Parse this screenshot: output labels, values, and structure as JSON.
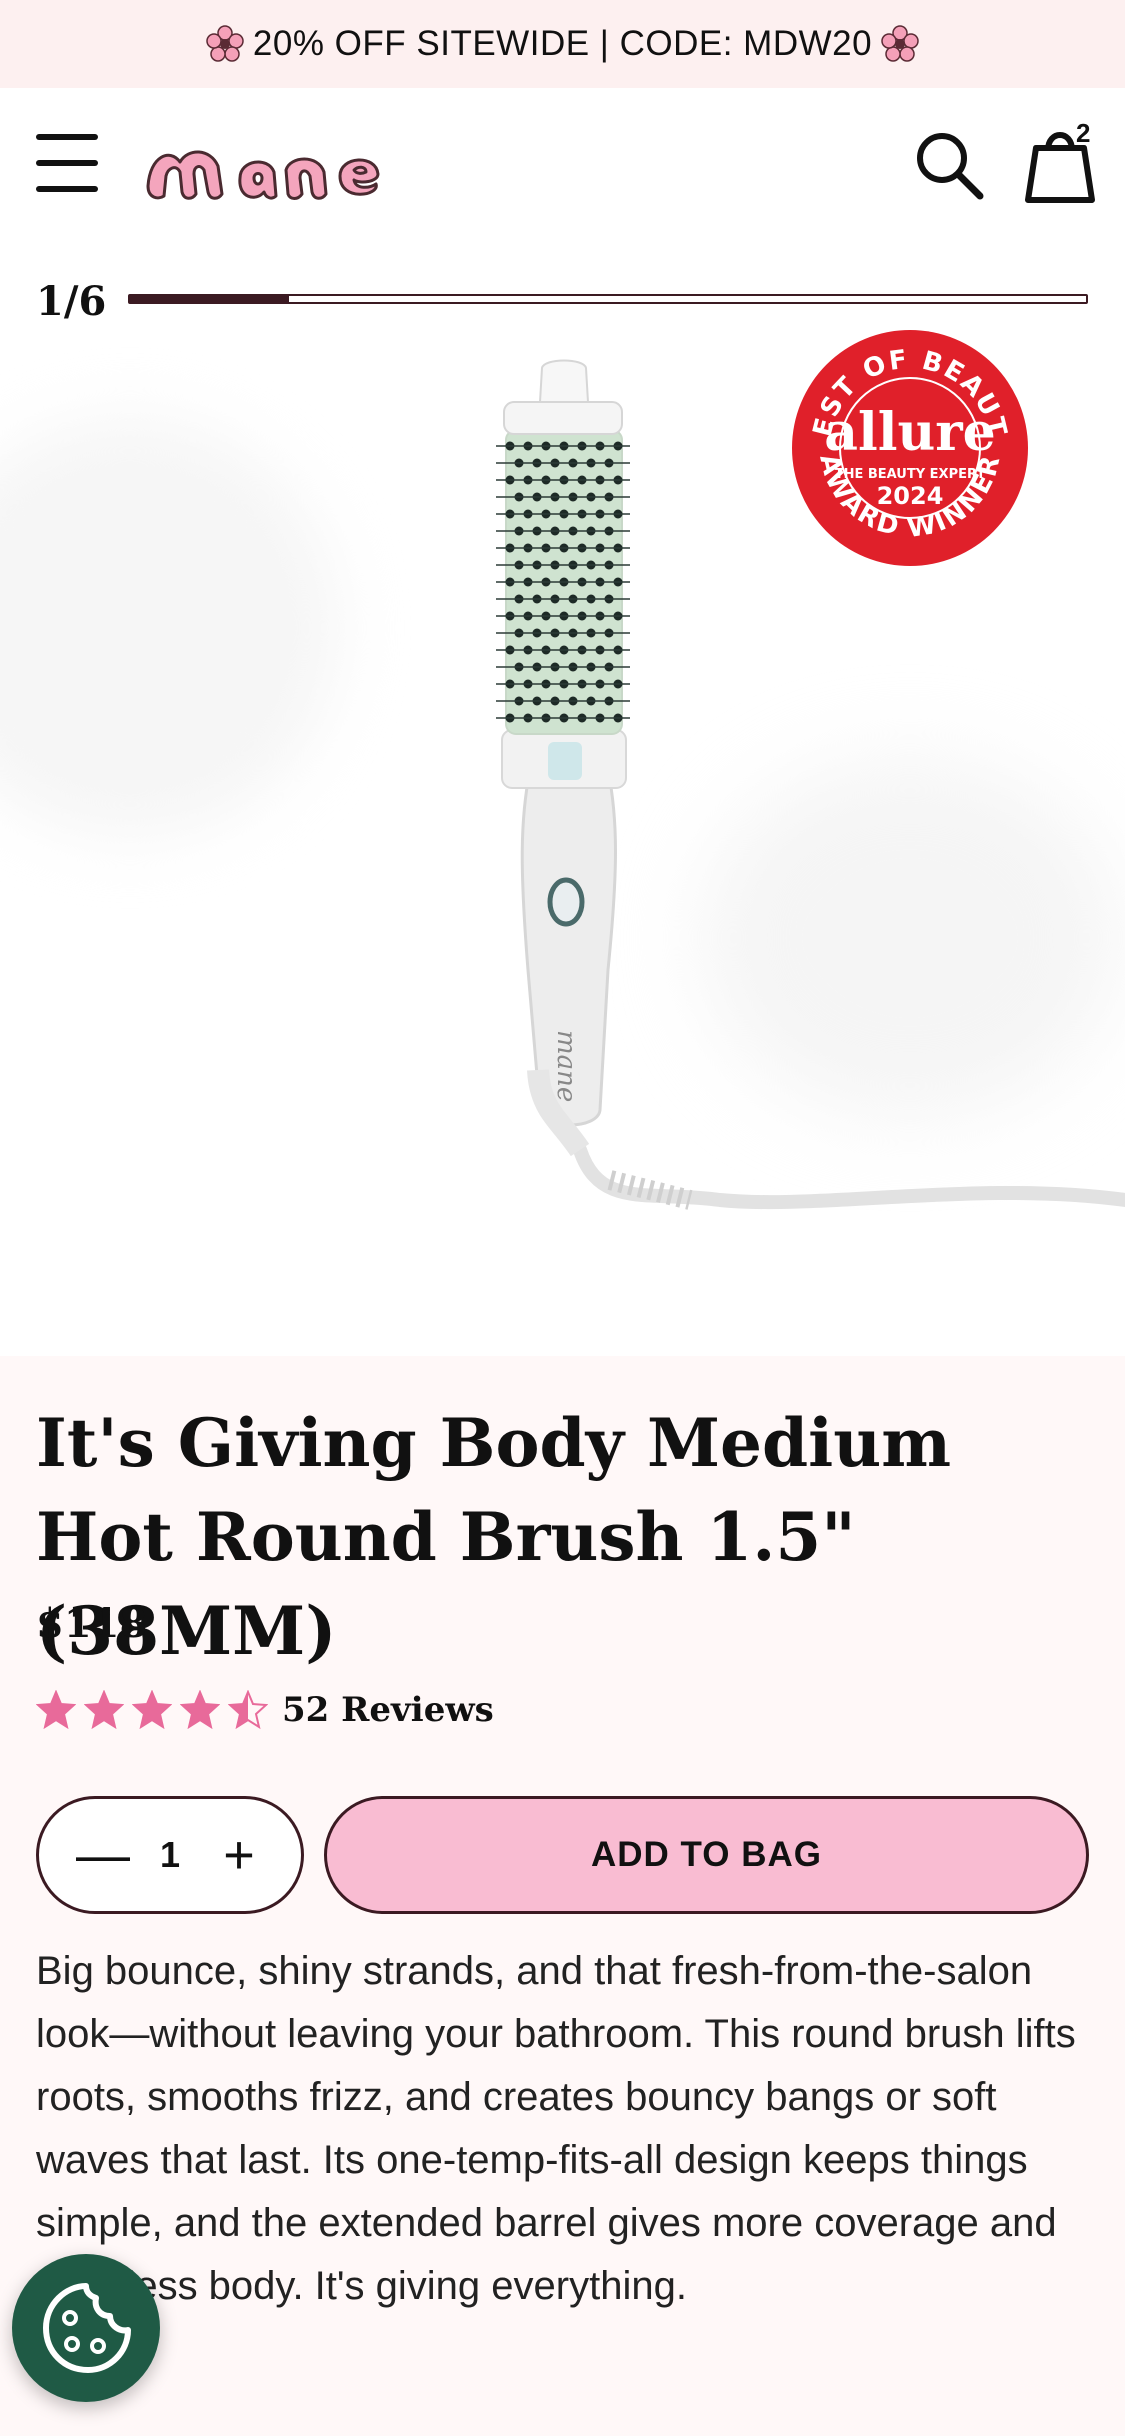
{
  "promo": {
    "text": "20% OFF SITEWIDE | CODE: MDW20"
  },
  "header": {
    "logo_alt": "mane",
    "cart_count": "2"
  },
  "gallery": {
    "counter": "1/6",
    "progress_fraction": 0.1667
  },
  "product": {
    "title": "It's Giving Body Medium Hot Round Brush 1.5\" (38MM)",
    "price": "$118",
    "rating": 4.5,
    "reviews": "52 Reviews",
    "quantity": "1",
    "add_to_bag": "ADD TO BAG",
    "description": "Big bounce, shiny strands, and that fresh-from-the-salon look—without leaving your bathroom. This round brush lifts roots, smooths frizz, and creates bouncy bangs or soft waves that last. Its one-temp-fits-all design keeps things simple, and the extended barrel gives more coverage and effortless body. It's giving everything."
  },
  "badge": {
    "top_text": "BEST OF BEAUTY",
    "brand": "allure",
    "subtitle": "THE BEAUTY EXPERT",
    "year": "2024",
    "bottom_text": "AWARD WINNER"
  },
  "icons": {
    "menu": "hamburger-icon",
    "search": "search-icon",
    "bag": "bag-icon",
    "star": "star-icon",
    "cookie": "cookie-icon",
    "flower": "flower-icon"
  },
  "colors": {
    "accent_pink": "#f9bcd2",
    "brand_dark": "#3b1a22",
    "star_pink": "#e86a9a",
    "cookie_green": "#1f5a45",
    "page_bg": "#fff8f8"
  }
}
